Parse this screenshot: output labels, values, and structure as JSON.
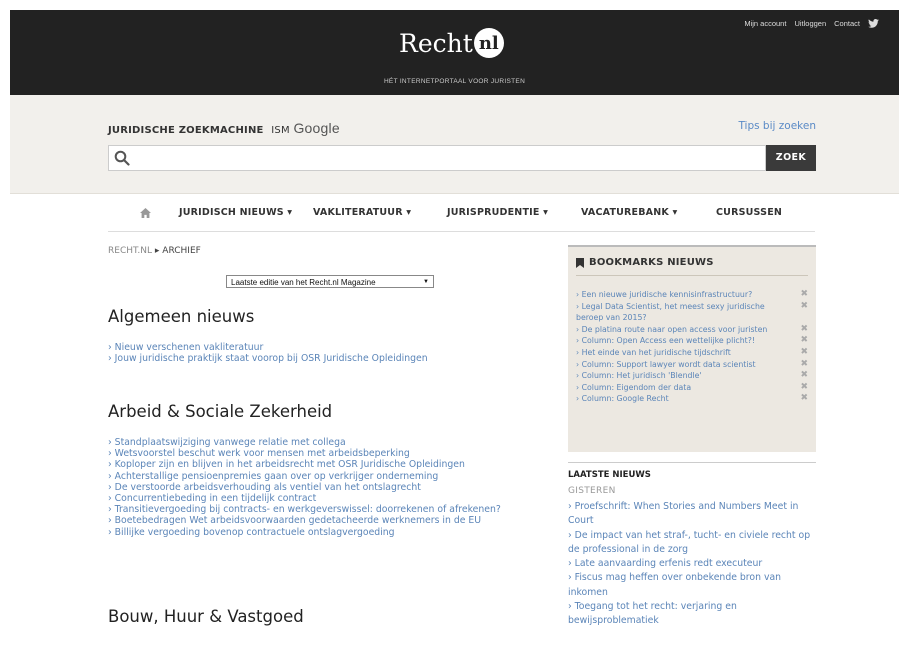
{
  "header": {
    "top_links": [
      "Mijn account",
      "Uitloggen",
      "Contact"
    ],
    "logo_text": "Recht",
    "logo_badge": "nl",
    "tagline": "HÉT INTERNETPORTAAL VOOR JURISTEN"
  },
  "search": {
    "title": "JURIDISCHE ZOEKMACHINE",
    "ism": "ISM",
    "google": "Google",
    "tips": "Tips bij zoeken",
    "button": "ZOEK",
    "value": ""
  },
  "nav": {
    "items": [
      "JURIDISCH NIEUWS ▾",
      "VAKLITERATUUR ▾",
      "JURISPRUDENTIE ▾",
      "VACATUREBANK ▾",
      "CURSUSSEN"
    ]
  },
  "breadcrumb": {
    "root": "RECHT.NL",
    "current": "▸ ARCHIEF"
  },
  "edition_select": "Laatste editie van het Recht.nl Magazine",
  "sections": [
    {
      "title": "Algemeen nieuws",
      "links": [
        "› Nieuw verschenen vakliteratuur",
        "› Jouw juridische praktijk staat voorop bij OSR Juridische Opleidingen"
      ]
    },
    {
      "title": "Arbeid & Sociale Zekerheid",
      "links": [
        "› Standplaatswijziging vanwege relatie met collega",
        "› Wetsvoorstel beschut werk voor mensen met arbeidsbeperking",
        "› Koploper zijn en blijven in het arbeidsrecht met OSR Juridische Opleidingen",
        "› Achterstallige pensioenpremies gaan over op verkrijger onderneming",
        "› De verstoorde arbeidsverhouding als ventiel van het ontslagrecht",
        "› Concurrentiebeding in een tijdelijk contract",
        "› Transitievergoeding bij contracts- en werkgeverswissel: doorrekenen of afrekenen?",
        "› Boetebedragen Wet arbeidsvoorwaarden gedetacheerde werknemers in de EU",
        "› Billijke vergoeding bovenop contractuele ontslagvergoeding"
      ]
    },
    {
      "title": "Bouw, Huur & Vastgoed",
      "links": []
    }
  ],
  "bookmarks": {
    "title": "BOOKMARKS NIEUWS",
    "items": [
      "› Een nieuwe juridische kennisinfrastructuur?",
      "› Legal Data Scientist, het meest sexy juridische beroep van 2015?",
      "› De platina route naar open access voor juristen",
      "› Column: Open Access een wettelijke plicht?!",
      "› Het einde van het juridische tijdschrift",
      "› Column: Support lawyer wordt data scientist",
      "› Column: Het juridisch 'Blendle'",
      "› Column: Eigendom der data",
      "› Column: Google Recht"
    ],
    "remove_symbol": "✖"
  },
  "latest_news": {
    "title": "LAATSTE NIEUWS",
    "day": "GISTEREN",
    "items": [
      "› Proefschrift: When Stories and Numbers Meet in Court",
      "› De impact van het straf-, tucht- en civiele recht op de professional in de zorg",
      "› Late aanvaarding erfenis redt executeur",
      "› Fiscus mag heffen over onbekende bron van inkomen",
      "› Toegang tot het recht: verjaring en bewijsproblematiek"
    ]
  }
}
